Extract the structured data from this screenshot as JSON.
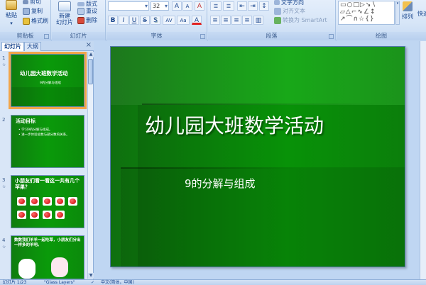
{
  "ribbon": {
    "clipboard": {
      "paste": "粘贴",
      "copy": "复制",
      "cut": "剪切",
      "format_painter": "格式刷",
      "label": "剪贴板"
    },
    "slides": {
      "new_slide": "新建\n幻灯片",
      "layout": "版式",
      "reset": "重设",
      "delete": "删除",
      "label": "幻灯片"
    },
    "font": {
      "font_name": "",
      "font_size": "32",
      "grow": "A",
      "shrink": "A",
      "clear": "A",
      "bold": "B",
      "italic": "I",
      "underline": "U",
      "strike": "S",
      "shadow": "S",
      "spacing": "AV",
      "case": "Aa",
      "color": "A",
      "label": "字体"
    },
    "paragraph": {
      "text_direction": "文字方向",
      "align_text": "对齐文本",
      "smartart": "转换为 SmartArt",
      "label": "段落"
    },
    "drawing": {
      "arrange": "排列",
      "quick_styles": "快速",
      "label": "绘图"
    }
  },
  "left_pane": {
    "tabs": [
      "幻灯片",
      "大纲"
    ],
    "close": "×",
    "thumbnails": [
      {
        "num": "1",
        "title": "幼儿园大班数学活动",
        "subtitle": "9的分解与组成"
      },
      {
        "num": "2",
        "title": "活动目标",
        "bullets": [
          "• 学习9的分解与组成。",
          "• 进一步体验总数与部分数的关系。"
        ]
      },
      {
        "num": "3",
        "title": "小朋友们看一看这一共有几个苹果？"
      },
      {
        "num": "4",
        "title": "数数我们羊羊一起吃草，小朋友们分出一样多的羊吧。"
      }
    ]
  },
  "slide": {
    "title": "幼儿园大班数学活动",
    "subtitle": "9的分解与组成"
  },
  "status": {
    "slide_index": "幻灯片 1/23",
    "theme": "\"Glass Layers\"",
    "language": "中文(简体，中国)"
  }
}
